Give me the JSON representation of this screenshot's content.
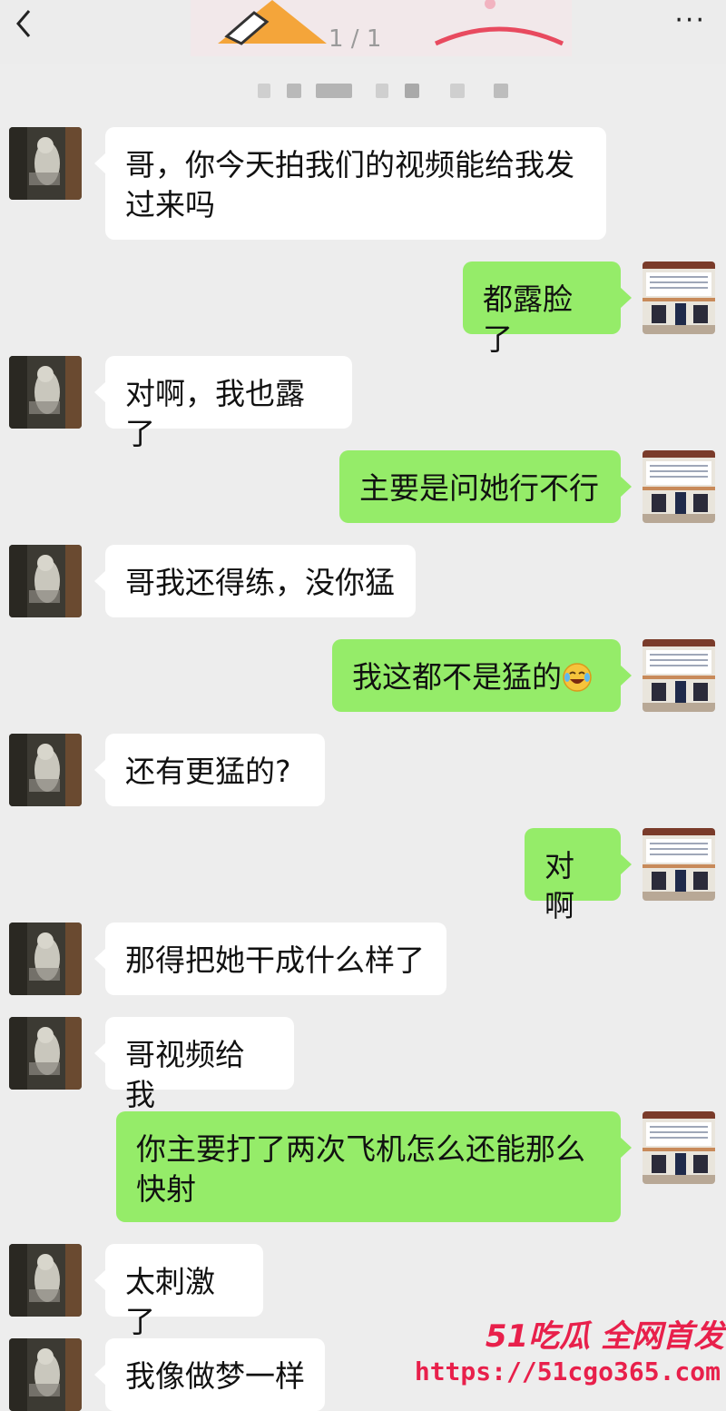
{
  "header": {
    "page_counter": "1 / 1",
    "colors": {
      "background": "#ededed",
      "incoming_bubble": "#ffffff",
      "outgoing_bubble": "#95ec69"
    }
  },
  "messages": [
    {
      "side": "left",
      "text": "哥，你今天拍我们的视频能给我发过来吗"
    },
    {
      "side": "right",
      "text": "都露脸了"
    },
    {
      "side": "left",
      "text": "对啊，我也露了"
    },
    {
      "side": "right",
      "text": "主要是问她行不行"
    },
    {
      "side": "left",
      "text": "哥我还得练，没你猛"
    },
    {
      "side": "right",
      "text": "我这都不是猛的",
      "emoji": "crying-laughing-emoji-icon"
    },
    {
      "side": "left",
      "text": "还有更猛的?"
    },
    {
      "side": "right",
      "text": "对啊"
    },
    {
      "side": "left",
      "text": "那得把她干成什么样了"
    },
    {
      "side": "left",
      "text": "哥视频给我"
    },
    {
      "side": "right",
      "text": "你主要打了两次飞机怎么还能那么快射"
    },
    {
      "side": "left",
      "text": "太刺激了"
    },
    {
      "side": "left",
      "text": "我像做梦一样"
    }
  ],
  "watermark": {
    "title": "51吃瓜 全网首发",
    "url": "https://51cgo365.com"
  }
}
